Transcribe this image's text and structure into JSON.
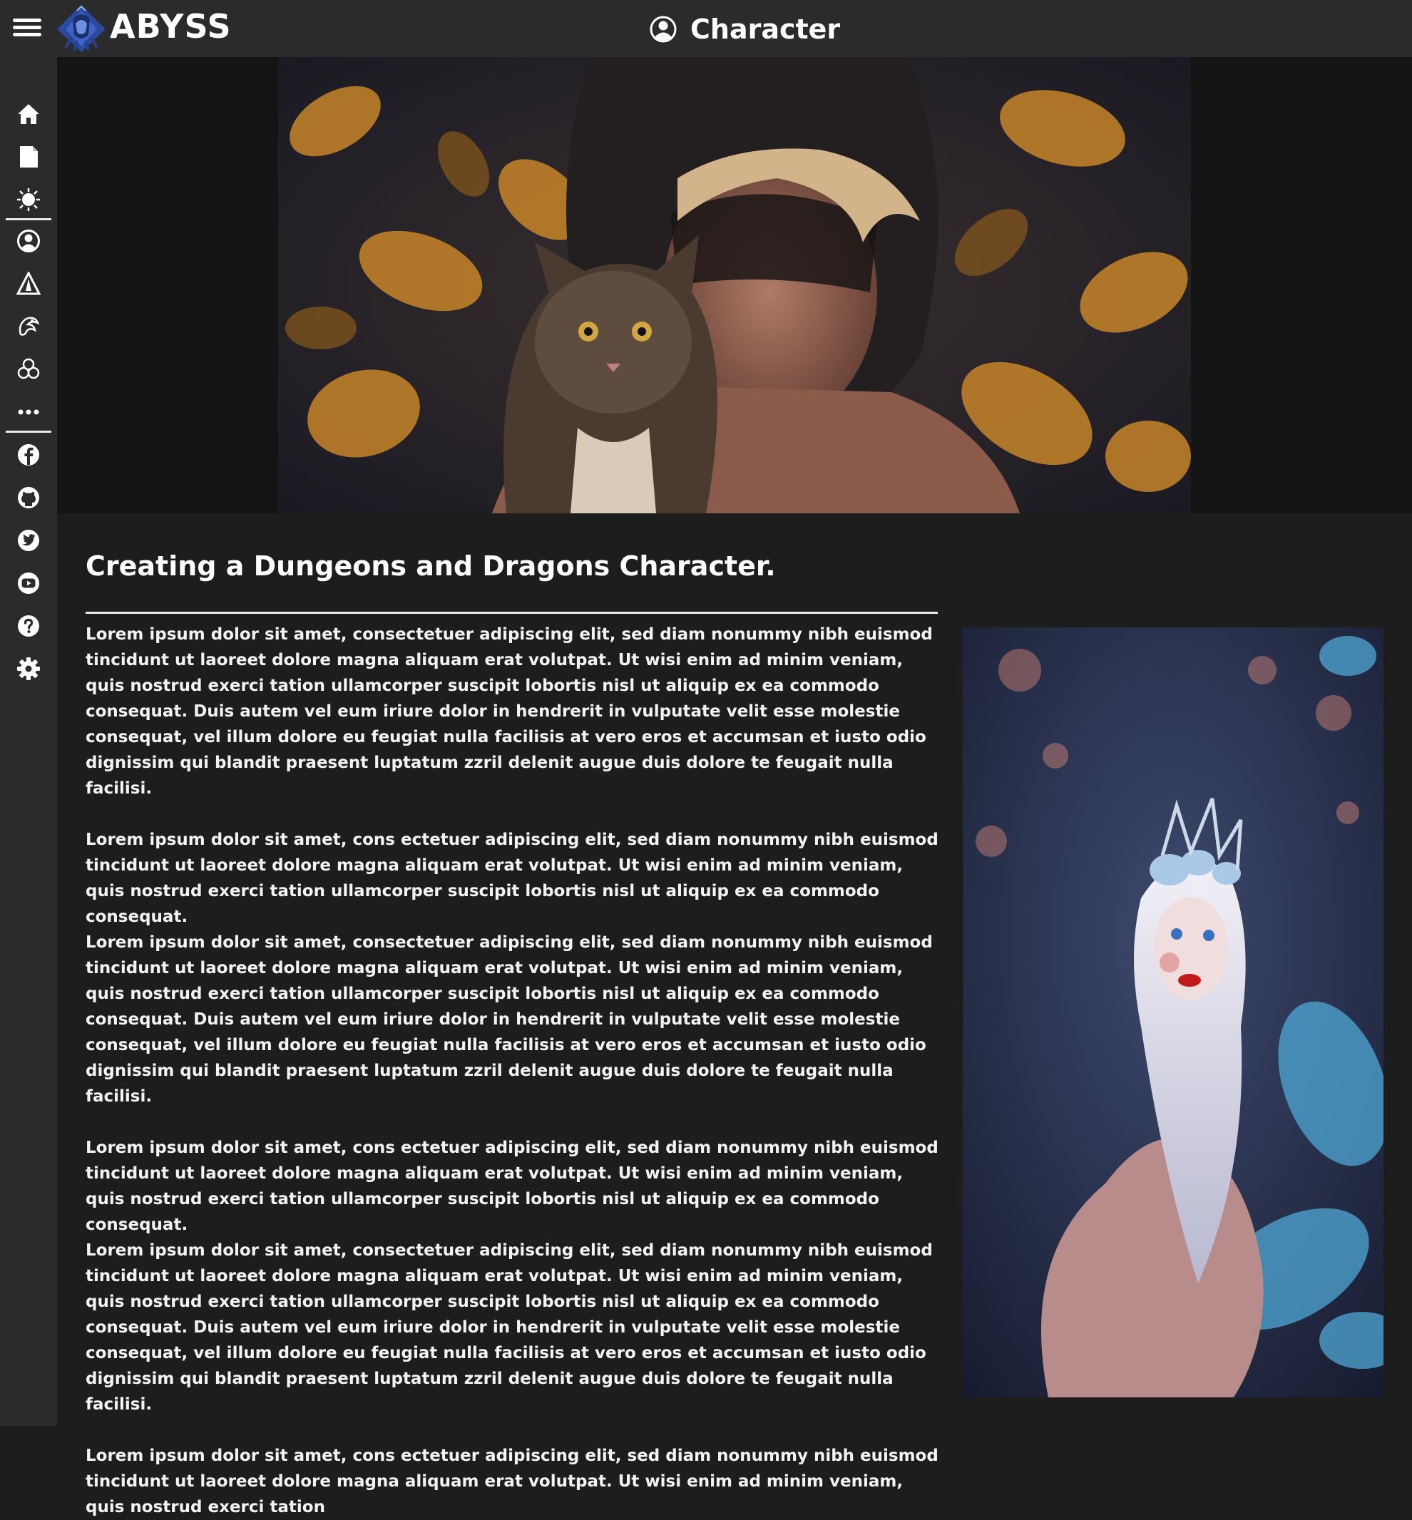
{
  "header": {
    "brand": "ABYSS",
    "page_title": "Character"
  },
  "sidebar": {
    "items": [
      {
        "name": "home",
        "icon": "home-icon"
      },
      {
        "name": "pages",
        "icon": "document-icon"
      },
      {
        "name": "spells",
        "icon": "sun-icon"
      },
      {
        "name": "character",
        "icon": "user-circle-icon"
      },
      {
        "name": "dungeon",
        "icon": "warning-triangle-icon"
      },
      {
        "name": "races",
        "icon": "dragon-icon"
      },
      {
        "name": "classes",
        "icon": "triquetra-icon"
      },
      {
        "name": "more",
        "icon": "more-dots-icon"
      },
      {
        "name": "facebook",
        "icon": "facebook-icon"
      },
      {
        "name": "github",
        "icon": "github-icon"
      },
      {
        "name": "twitter",
        "icon": "twitter-icon"
      },
      {
        "name": "youtube",
        "icon": "youtube-icon"
      },
      {
        "name": "help",
        "icon": "help-icon"
      },
      {
        "name": "settings",
        "icon": "gear-icon"
      }
    ]
  },
  "article": {
    "title": "Creating a Dungeons and Dragons Character.",
    "paragraphs": [
      "Lorem ipsum dolor sit amet, consectetuer adipiscing elit, sed diam nonummy nibh euismod tincidunt ut laoreet dolore magna aliquam erat volutpat. Ut wisi enim ad minim veniam, quis nostrud exerci tation ullamcorper suscipit lobortis nisl ut aliquip ex ea commodo consequat. Duis autem vel eum iriure dolor in hendrerit in vulputate velit esse molestie consequat, vel illum dolore eu feugiat nulla facilisis at vero eros et accumsan et iusto odio dignissim qui blandit praesent luptatum zzril delenit augue duis dolore te feugait nulla facilisi.",
      "Lorem ipsum dolor sit amet, cons ectetuer adipiscing elit, sed diam nonummy nibh euismod tincidunt ut laoreet dolore magna aliquam erat volutpat. Ut wisi enim ad minim veniam, quis nostrud exerci tation ullamcorper suscipit lobortis nisl ut aliquip ex ea commodo consequat.",
      "Lorem ipsum dolor sit amet, consectetuer adipiscing elit, sed diam nonummy nibh euismod tincidunt ut laoreet dolore magna aliquam erat volutpat. Ut wisi enim ad minim veniam, quis nostrud exerci tation ullamcorper suscipit lobortis nisl ut aliquip ex ea commodo consequat. Duis autem vel eum iriure dolor in hendrerit in vulputate velit esse molestie consequat, vel illum dolore eu feugiat nulla facilisis at vero eros et accumsan et iusto odio dignissim qui blandit praesent luptatum zzril delenit augue duis dolore te feugait nulla facilisi.",
      "Lorem ipsum dolor sit amet, cons ectetuer adipiscing elit, sed diam nonummy nibh euismod tincidunt ut laoreet dolore magna aliquam erat volutpat. Ut wisi enim ad minim veniam, quis nostrud exerci tation ullamcorper suscipit lobortis nisl ut aliquip ex ea commodo consequat.",
      "Lorem ipsum dolor sit amet, consectetuer adipiscing elit, sed diam nonummy nibh euismod tincidunt ut laoreet dolore magna aliquam erat volutpat. Ut wisi enim ad minim veniam, quis nostrud exerci tation ullamcorper suscipit lobortis nisl ut aliquip ex ea commodo consequat. Duis autem vel eum iriure dolor in hendrerit in vulputate velit esse molestie consequat, vel illum dolore eu feugiat nulla facilisis at vero eros et accumsan et iusto odio dignissim qui blandit praesent luptatum zzril delenit augue duis dolore te feugait nulla facilisi.",
      "Lorem ipsum dolor sit amet, cons ectetuer adipiscing elit, sed diam nonummy nibh euismod tincidunt ut laoreet dolore magna aliquam erat volutpat. Ut wisi enim ad minim veniam, quis nostrud exerci tation"
    ]
  },
  "colors": {
    "topbar": "#2b2b2c",
    "content_bg": "#1d1d1e",
    "hero_band": "#141414",
    "text": "#ffffff",
    "logo_blue": "#2a4a9e"
  }
}
